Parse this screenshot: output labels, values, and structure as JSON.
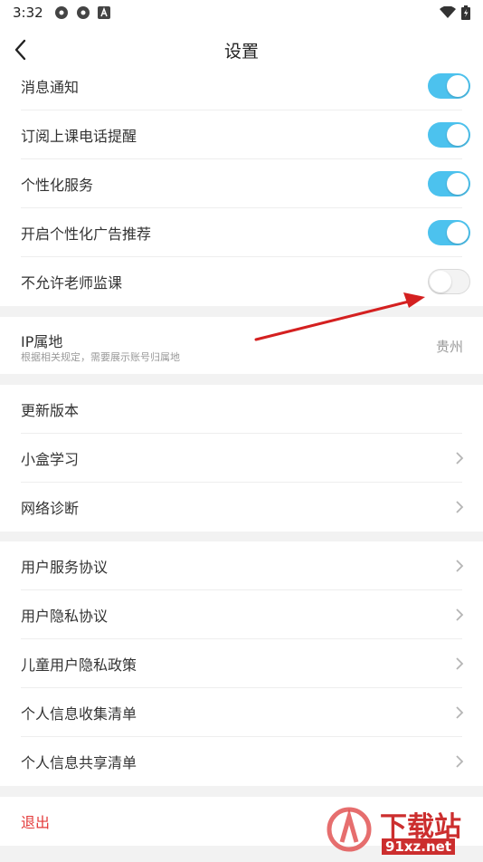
{
  "status_bar": {
    "time": "3:32"
  },
  "header": {
    "title": "设置"
  },
  "toggles": [
    {
      "label": "消息通知",
      "on": true
    },
    {
      "label": "订阅上课电话提醒",
      "on": true
    },
    {
      "label": "个性化服务",
      "on": true
    },
    {
      "label": "开启个性化广告推荐",
      "on": true
    },
    {
      "label": "不允许老师监课",
      "on": false
    }
  ],
  "ip_location": {
    "title": "IP属地",
    "subtitle": "根据相关规定，需要展示账号归属地",
    "value": "贵州"
  },
  "app_group": [
    {
      "label": "更新版本"
    },
    {
      "label": "小盒学习"
    },
    {
      "label": "网络诊断"
    }
  ],
  "legal_group": [
    {
      "label": "用户服务协议"
    },
    {
      "label": "用户隐私协议"
    },
    {
      "label": "儿童用户隐私政策"
    },
    {
      "label": "个人信息收集清单"
    },
    {
      "label": "个人信息共享清单"
    }
  ],
  "logout": {
    "label": "退出"
  },
  "watermark": {
    "text": "下载站",
    "url_text": "91xz.net"
  },
  "colors": {
    "toggle_on": "#4cc2ee",
    "logout_text": "#e33b3b",
    "annotation_arrow": "#d42020"
  },
  "icons": {
    "status_left": [
      "app-icon-1",
      "app-icon-2",
      "a-icon"
    ],
    "status_right": [
      "wifi-icon",
      "battery-icon"
    ],
    "back": "back-arrow-icon",
    "chevron": "chevron-right-icon"
  }
}
